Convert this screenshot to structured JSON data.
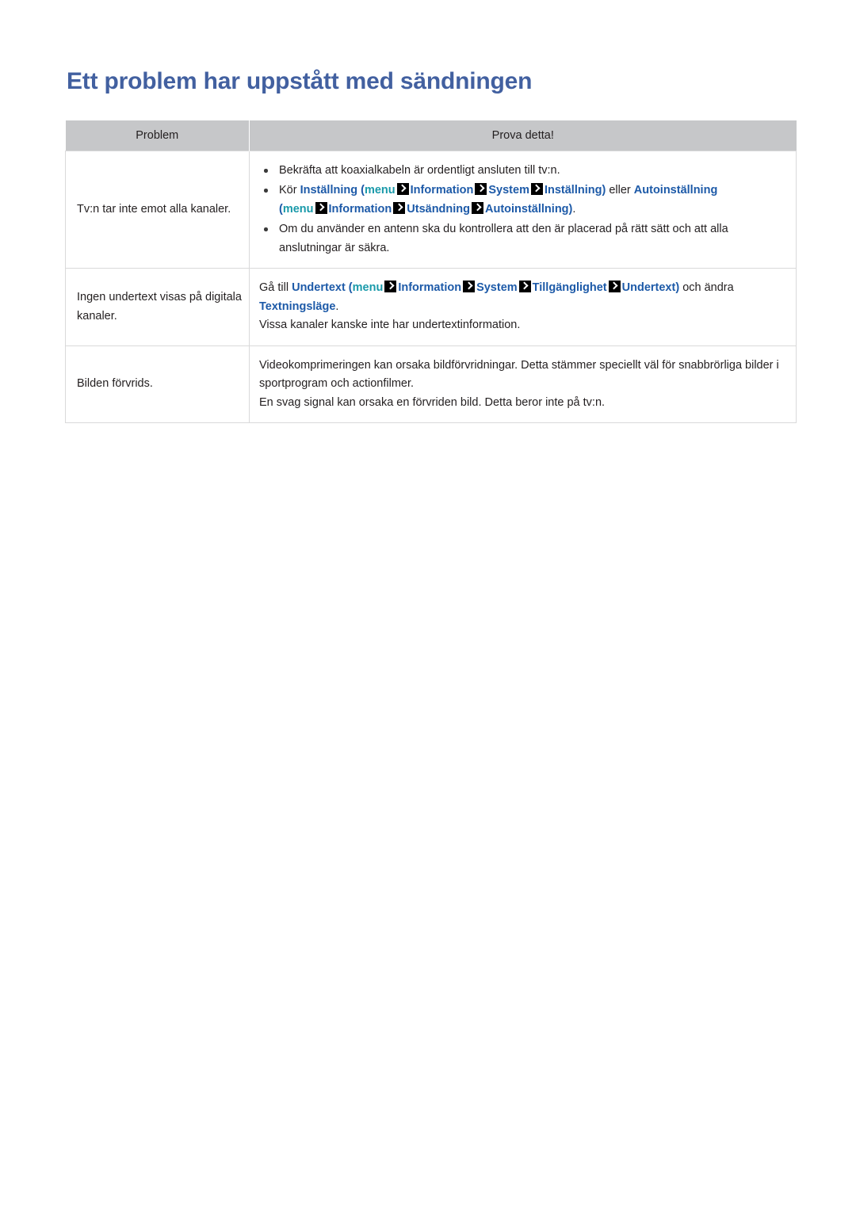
{
  "page": {
    "title": "Ett problem har uppstått med sändningen",
    "title_color": "#4260a0",
    "background": "#ffffff",
    "text_color": "#231f20"
  },
  "colors": {
    "header_bg": "#c6c7c9",
    "cell_border": "#d9d9da",
    "link_blue": "#1d5aa8",
    "menu_teal": "#1a9aaa",
    "arrow_bg": "#000000"
  },
  "table": {
    "columns": [
      {
        "label": "Problem"
      },
      {
        "label": "Prova detta!"
      }
    ],
    "rows": [
      {
        "problem": "Tv:n tar inte emot alla kanaler.",
        "solution_type": "bullets",
        "bullets": [
          {
            "lines": [
              {
                "runs": [
                  {
                    "text": "Bekräfta att koaxialkabeln är ordentligt ansluten till tv:n.",
                    "style": "plain"
                  }
                ]
              }
            ]
          },
          {
            "lines": [
              {
                "runs": [
                  {
                    "text": "Kör ",
                    "style": "plain"
                  },
                  {
                    "text": "Inställning",
                    "style": "blue"
                  },
                  {
                    "text": " (",
                    "style": "paren"
                  },
                  {
                    "text": "menu",
                    "style": "teal"
                  },
                  {
                    "text": "",
                    "style": "arrow"
                  },
                  {
                    "text": "Information",
                    "style": "blue"
                  },
                  {
                    "text": "",
                    "style": "arrow"
                  },
                  {
                    "text": "System",
                    "style": "blue"
                  },
                  {
                    "text": "",
                    "style": "arrow"
                  },
                  {
                    "text": "Inställning",
                    "style": "blue"
                  },
                  {
                    "text": ")",
                    "style": "paren"
                  },
                  {
                    "text": " eller ",
                    "style": "plain"
                  },
                  {
                    "text": "Autoinställning",
                    "style": "blue"
                  }
                ]
              },
              {
                "runs": [
                  {
                    "text": "(",
                    "style": "paren"
                  },
                  {
                    "text": "menu",
                    "style": "teal"
                  },
                  {
                    "text": "",
                    "style": "arrow"
                  },
                  {
                    "text": "Information",
                    "style": "blue"
                  },
                  {
                    "text": "",
                    "style": "arrow"
                  },
                  {
                    "text": "Utsändning",
                    "style": "blue"
                  },
                  {
                    "text": "",
                    "style": "arrow"
                  },
                  {
                    "text": "Autoinställning",
                    "style": "blue"
                  },
                  {
                    "text": ")",
                    "style": "paren"
                  },
                  {
                    "text": ".",
                    "style": "plain"
                  }
                ]
              }
            ]
          },
          {
            "lines": [
              {
                "runs": [
                  {
                    "text": "Om du använder en antenn ska du kontrollera att den är placerad på rätt sätt och att alla anslutningar är säkra.",
                    "style": "plain"
                  }
                ]
              }
            ]
          }
        ]
      },
      {
        "problem": "Ingen undertext visas på digitala kanaler.",
        "solution_type": "paragraphs",
        "paragraphs": [
          {
            "runs": [
              {
                "text": "Gå till ",
                "style": "plain"
              },
              {
                "text": "Undertext",
                "style": "blue"
              },
              {
                "text": " (",
                "style": "paren"
              },
              {
                "text": "menu",
                "style": "teal"
              },
              {
                "text": "",
                "style": "arrow"
              },
              {
                "text": "Information",
                "style": "blue"
              },
              {
                "text": "",
                "style": "arrow"
              },
              {
                "text": "System",
                "style": "blue"
              },
              {
                "text": "",
                "style": "arrow"
              },
              {
                "text": "Tillgänglighet",
                "style": "blue"
              },
              {
                "text": "",
                "style": "arrow"
              },
              {
                "text": "Undertext",
                "style": "blue"
              },
              {
                "text": ")",
                "style": "paren"
              },
              {
                "text": " och ändra ",
                "style": "plain"
              },
              {
                "text": "Textningsläge",
                "style": "blue"
              },
              {
                "text": ".",
                "style": "plain"
              }
            ]
          },
          {
            "runs": [
              {
                "text": "Vissa kanaler kanske inte har undertextinformation.",
                "style": "plain"
              }
            ]
          }
        ]
      },
      {
        "problem": "Bilden förvrids.",
        "solution_type": "paragraphs",
        "paragraphs": [
          {
            "runs": [
              {
                "text": "Videokomprimeringen kan orsaka bildförvridningar. Detta stämmer speciellt väl för snabbrörliga bilder i sportprogram och actionfilmer.",
                "style": "plain"
              }
            ]
          },
          {
            "runs": [
              {
                "text": "En svag signal kan orsaka en förvriden bild. Detta beror inte på tv:n.",
                "style": "plain"
              }
            ]
          }
        ]
      }
    ]
  }
}
